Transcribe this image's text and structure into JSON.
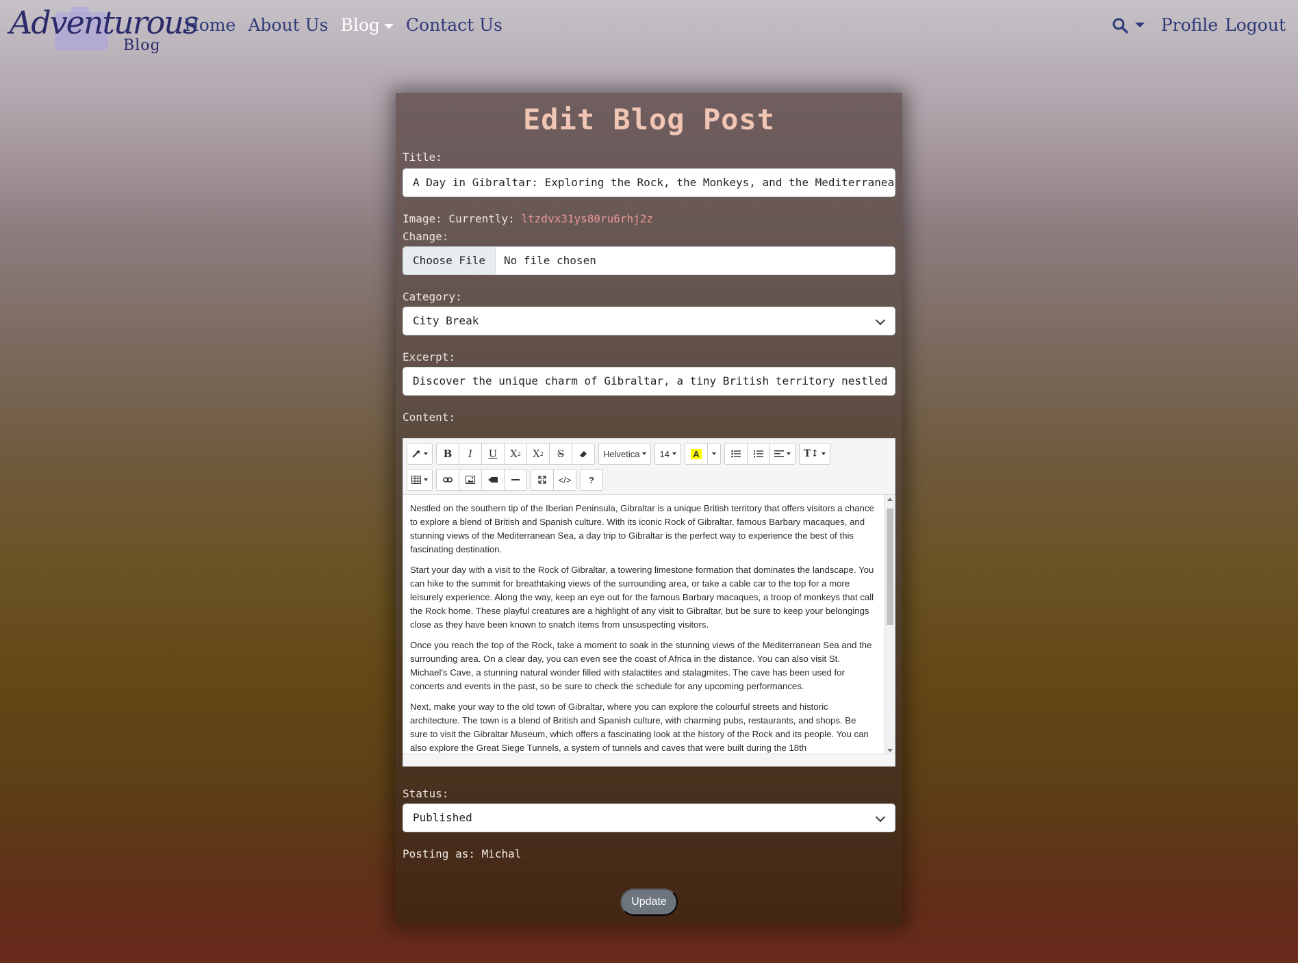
{
  "brand": {
    "name": "Adventurous",
    "sub": "Blog"
  },
  "nav": {
    "links": [
      "Home",
      "About Us",
      "Blog",
      "Contact Us"
    ],
    "right": [
      "Profile",
      "Logout"
    ]
  },
  "form": {
    "heading": "Edit Blog Post",
    "title_label": "Title:",
    "title_value": "A Day in Gibraltar: Exploring the Rock, the Monkeys, and the Mediterranean",
    "image_label": "Image: Currently:",
    "image_current": "ltzdvx31ys80ru6rhj2z",
    "change_label": "Change:",
    "file_button": "Choose File",
    "file_status": "No file chosen",
    "category_label": "Category:",
    "category_value": "City Break",
    "excerpt_label": "Excerpt:",
    "excerpt_value": "Discover the unique charm of Gibraltar, a tiny British territory nestled on t",
    "content_label": "Content:",
    "status_label": "Status:",
    "status_value": "Published",
    "posting_as": "Posting as: Michal",
    "submit": "Update"
  },
  "editor": {
    "font_name": "Helvetica",
    "font_size": "14",
    "paragraphs": [
      "Nestled on the southern tip of the Iberian Peninsula, Gibraltar is a unique British territory that offers visitors a chance to explore a blend of British and Spanish culture. With its iconic Rock of Gibraltar, famous Barbary macaques, and stunning views of the Mediterranean Sea, a day trip to Gibraltar is the perfect way to experience the best of this fascinating destination.",
      "Start your day with a visit to the Rock of Gibraltar, a towering limestone formation that dominates the landscape. You can hike to the summit for breathtaking views of the surrounding area, or take a cable car to the top for a more leisurely experience. Along the way, keep an eye out for the famous Barbary macaques, a troop of monkeys that call the Rock home. These playful creatures are a highlight of any visit to Gibraltar, but be sure to keep your belongings close as they have been known to snatch items from unsuspecting visitors.",
      "Once you reach the top of the Rock, take a moment to soak in the stunning views of the Mediterranean Sea and the surrounding area. On a clear day, you can even see the coast of Africa in the distance. You can also visit St. Michael's Cave, a stunning natural wonder filled with stalactites and stalagmites. The cave has been used for concerts and events in the past, so be sure to check the schedule for any upcoming performances.",
      "Next, make your way to the old town of Gibraltar, where you can explore the colourful streets and historic architecture. The town is a blend of British and Spanish culture, with charming pubs, restaurants, and shops. Be sure to visit the Gibraltar Museum, which offers a fascinating look at the history of the Rock and its people. You can also explore the Great Siege Tunnels, a system of tunnels and caves that were built during the 18th"
    ]
  },
  "colors": {
    "heading": "#f1c5b3",
    "nav_link": "#2e3a78",
    "link": "#e99892",
    "button": "#6c757d"
  }
}
